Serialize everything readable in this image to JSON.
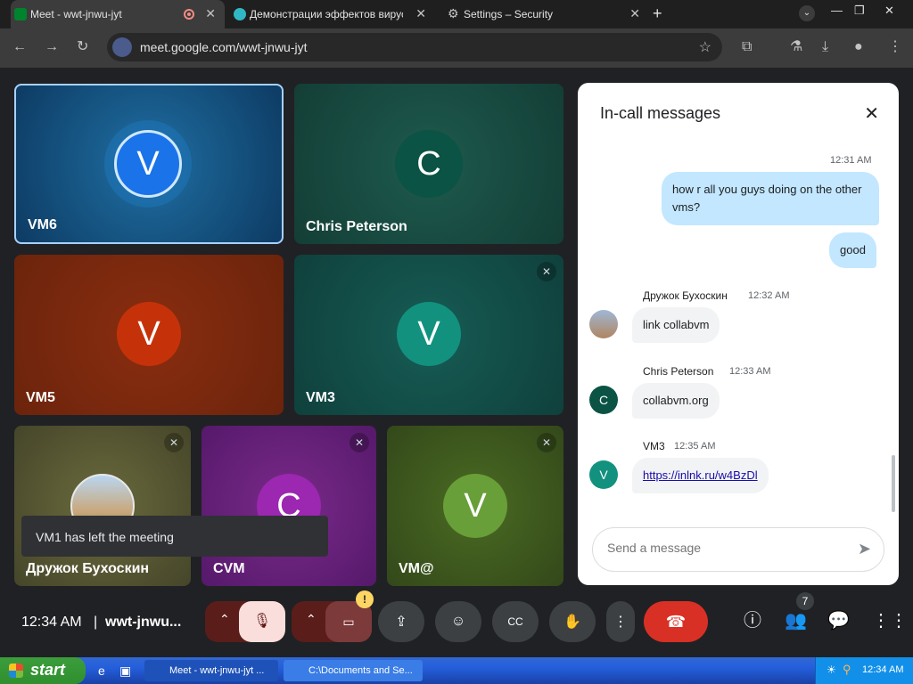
{
  "browser": {
    "tabs": [
      {
        "label": "Meet - wwt-jnwu-jyt"
      },
      {
        "label": "Демонстрации эффектов вирусов"
      },
      {
        "label": "Settings – Security"
      }
    ],
    "url": "meet.google.com/wwt-jnwu-jyt"
  },
  "tiles": [
    {
      "initial": "V",
      "name": "VM6",
      "color": "#1a73e8"
    },
    {
      "initial": "C",
      "name": "Chris Peterson",
      "color": "#0b5345"
    },
    {
      "initial": "V",
      "name": "VM5",
      "color": "#c5320a"
    },
    {
      "initial": "V",
      "name": "VM3",
      "color": "#12917f"
    },
    {
      "initial": "",
      "name": "Дружок Бухоскин",
      "color": "#6b6b3d"
    },
    {
      "initial": "C",
      "name": "CVM",
      "color": "#9c27b0"
    },
    {
      "initial": "V",
      "name": "VM@",
      "color": "#689f38"
    }
  ],
  "toast": "VM1 has left the meeting",
  "chat": {
    "title": "In-call messages",
    "out_time": "12:31 AM",
    "out_messages": [
      "how r all you guys doing on the other vms?",
      "good"
    ],
    "messages": [
      {
        "initial": "",
        "sender": "Дружок Бухоскин",
        "time": "12:32 AM",
        "text": "link collabvm"
      },
      {
        "initial": "C",
        "sender": "Chris Peterson",
        "time": "12:33 AM",
        "text": "collabvm.org"
      },
      {
        "initial": "V",
        "sender": "VM3",
        "time": "12:35 AM",
        "text": "https://inlnk.ru/w4BzDl"
      }
    ],
    "placeholder": "Send a message"
  },
  "controls": {
    "clock": "12:34 AM",
    "separator": "|",
    "meeting_code": "wwt-jnwu...",
    "people_count": "7",
    "camera_warning": "!"
  },
  "taskbar": {
    "start": "start",
    "tasks": [
      "Meet - wwt-jnwu-jyt ...",
      "C:\\Documents and Se..."
    ],
    "time": "12:34 AM"
  }
}
